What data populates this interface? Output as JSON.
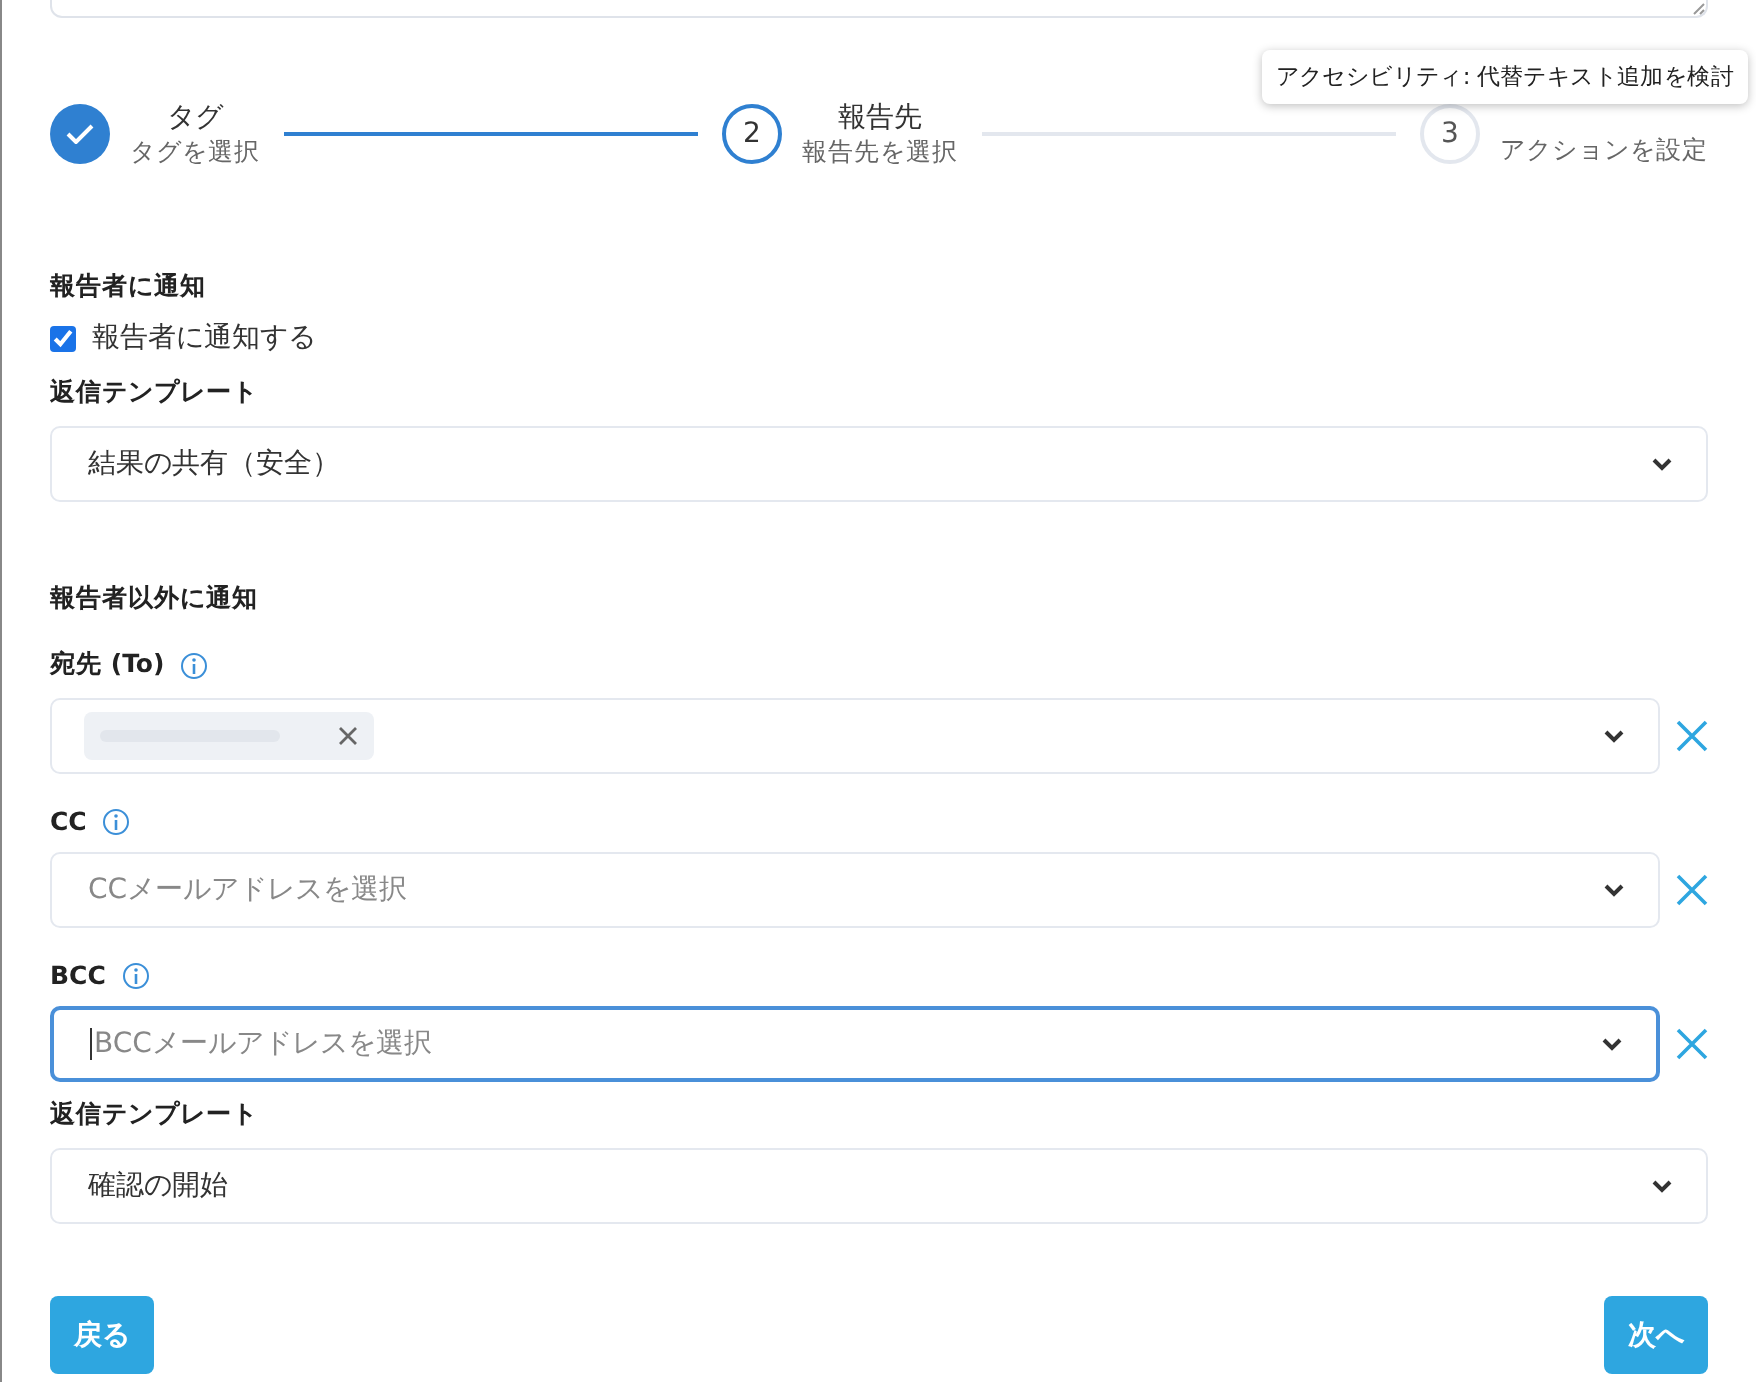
{
  "tooltip": "アクセシビリティ: 代替テキスト追加を検討",
  "steps": [
    {
      "title": "タグ",
      "subtitle": "タグを選択",
      "completed": true,
      "selected": false
    },
    {
      "number": "2",
      "title": "報告先",
      "subtitle": "報告先を選択",
      "completed": false,
      "selected": true
    },
    {
      "number": "3",
      "subtitle": "アクションを設定",
      "completed": false,
      "selected": false
    }
  ],
  "notify_reporter": {
    "heading": "報告者に通知",
    "checkbox": {
      "label": "報告者に通知する",
      "checked": true
    },
    "template_label": "返信テンプレート",
    "template_value": "結果の共有（安全）"
  },
  "notify_others": {
    "heading": "報告者以外に通知",
    "fields": [
      {
        "label": "宛先 (To)",
        "chips": [
          {
            "kind": "redacted"
          }
        ],
        "focused": false
      },
      {
        "label": "CC",
        "placeholder": "CCメールアドレスを選択",
        "focused": false
      },
      {
        "label": "BCC",
        "placeholder": "BCCメールアドレスを選択",
        "focused": true
      }
    ],
    "template_label": "返信テンプレート",
    "template_value": "確認の開始"
  },
  "buttons": [
    {
      "label": "戻る"
    },
    {
      "label": "次へ"
    }
  ]
}
